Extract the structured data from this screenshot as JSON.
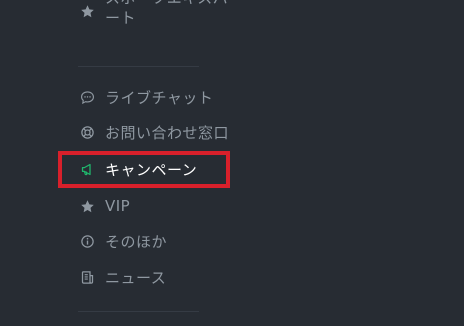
{
  "menu": {
    "top_item": {
      "label_line1": "スポーツエキスパ",
      "label_line2": "ート",
      "icon": "star-icon"
    },
    "items": [
      {
        "label": "ライブチャット",
        "icon": "chat-bubble-icon"
      },
      {
        "label": "お問い合わせ窓口",
        "icon": "lifebuoy-icon"
      },
      {
        "label": "キャンペーン",
        "icon": "megaphone-icon",
        "active": true
      },
      {
        "label": "VIP",
        "icon": "star-icon"
      },
      {
        "label": "そのほか",
        "icon": "info-icon"
      },
      {
        "label": "ニュース",
        "icon": "newspaper-icon"
      }
    ]
  },
  "colors": {
    "background": "#272c33",
    "text": "#8f98a1",
    "active_text": "#ffffff",
    "active_icon": "#1fb86d",
    "highlight": "#d8202b",
    "divider": "#353b44"
  }
}
